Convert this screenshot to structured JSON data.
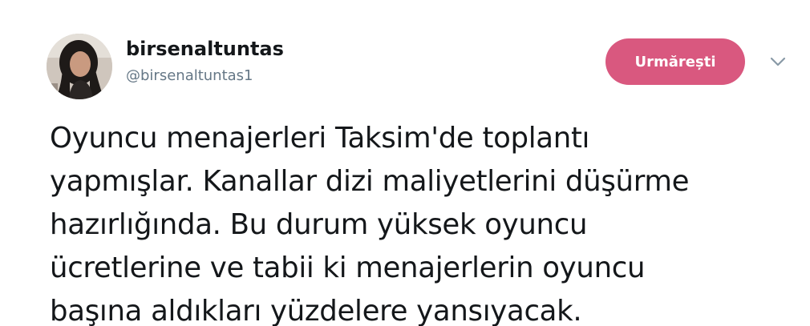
{
  "tweet": {
    "author": {
      "display_name": "birsenaltuntas",
      "handle": "@birsenaltuntas1",
      "avatar_icon": "profile-photo"
    },
    "follow_button": {
      "label": "Urmărești",
      "color": "#d9587f"
    },
    "menu_icon": "chevron-down-icon",
    "text_lines": [
      "Oyuncu menajerleri Taksim'de toplantı",
      "yapmışlar. Kanallar dizi maliyetlerini düşürme",
      "hazırlığında. Bu durum yüksek oyuncu",
      "ücretlerine ve tabii ki menajerlerin oyuncu",
      "başına aldıkları yüzdelere yansıyacak."
    ]
  }
}
